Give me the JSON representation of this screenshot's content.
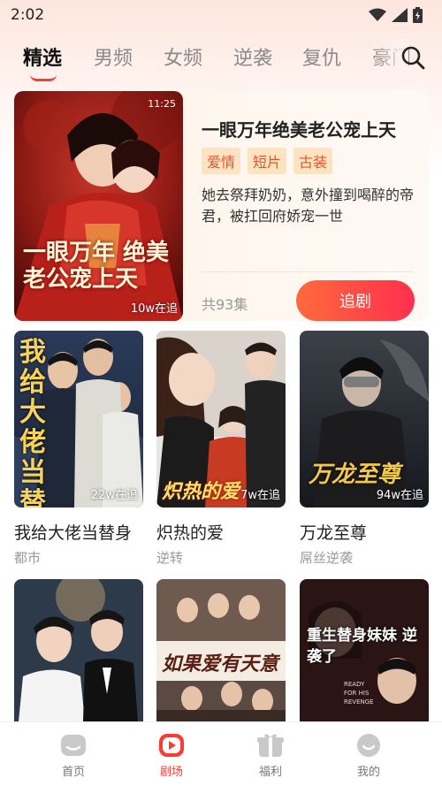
{
  "status": {
    "time": "2:02"
  },
  "tabs": [
    {
      "label": "精选",
      "active": true
    },
    {
      "label": "男频",
      "active": false
    },
    {
      "label": "女频",
      "active": false
    },
    {
      "label": "逆袭",
      "active": false
    },
    {
      "label": "复仇",
      "active": false
    },
    {
      "label": "豪门",
      "active": false
    }
  ],
  "search": {
    "icon": "search-icon"
  },
  "featured": {
    "title": "一眼万年绝美老公宠上天",
    "tags": [
      "爱情",
      "短片",
      "古装"
    ],
    "description": "她去祭拜奶奶，意外撞到喝醉的帝君，被扛回府娇宠一世",
    "episodes": "共93集",
    "follow_label": "追剧",
    "cover_time": "11:25",
    "cover_text": "一眼万年 绝美老公宠上天",
    "views": "10w在追"
  },
  "cards": [
    {
      "title": "我给大佬当替身",
      "genre": "都市",
      "views": "22w在追",
      "cover_text": "我给大佬当替身"
    },
    {
      "title": "炽热的爱",
      "genre": "逆转",
      "views": "7w在追",
      "cover_text": "炽热的爱"
    },
    {
      "title": "万龙至尊",
      "genre": "屌丝逆袭",
      "views": "94w在追",
      "cover_text": "万龙至尊"
    }
  ],
  "cards_row2": [
    {
      "cover_text": ""
    },
    {
      "cover_text": "如果爱有天意"
    },
    {
      "cover_text": "重生替身妹妹 逆袭了",
      "cover_subtext": "READY FOR HIS REVENGE"
    }
  ],
  "bottom_nav": [
    {
      "label": "首页",
      "icon": "home-icon",
      "active": false
    },
    {
      "label": "剧场",
      "icon": "theater-play-icon",
      "active": true
    },
    {
      "label": "福利",
      "icon": "gift-icon",
      "active": false
    },
    {
      "label": "我的",
      "icon": "profile-icon",
      "active": false
    }
  ],
  "colors": {
    "accent": "#ff3b30",
    "tag_bg": "#fde3c2",
    "tag_text": "#e2552b",
    "button_gradient_start": "#ff6a3d",
    "button_gradient_end": "#ff2f4e"
  }
}
